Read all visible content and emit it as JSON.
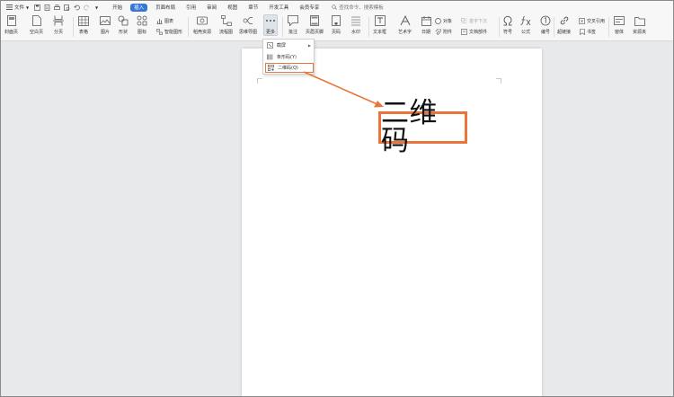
{
  "menubar": {
    "file_label": "文件",
    "tabs": [
      {
        "label": "开始",
        "active": false
      },
      {
        "label": "插入",
        "active": true
      },
      {
        "label": "页面布局",
        "active": false
      },
      {
        "label": "引用",
        "active": false
      },
      {
        "label": "审阅",
        "active": false
      },
      {
        "label": "视图",
        "active": false
      },
      {
        "label": "章节",
        "active": false
      },
      {
        "label": "开发工具",
        "active": false
      },
      {
        "label": "会员专享",
        "active": false
      }
    ],
    "search_placeholder": "查找命令、搜索模板"
  },
  "ribbon": {
    "cover": "封面页",
    "blank": "空白页",
    "pagebreak": "分页",
    "table": "表格",
    "picture": "图片",
    "shape": "形状",
    "icon": "图标",
    "chart": "图表",
    "smart": "智能图形",
    "material": "稻壳资源",
    "flow": "流程图",
    "mind": "思维导图",
    "more": "更多",
    "comment": "批注",
    "header": "页眉页脚",
    "pagenum": "页码",
    "watermark": "水印",
    "textbox": "文本框",
    "art": "艺术字",
    "date": "日期",
    "object": "对象",
    "attach": "附件",
    "dropcap": "首字下沉",
    "docpart": "文档部件",
    "symbol": "符号",
    "formula": "公式",
    "numbering": "编号",
    "hyperlink": "超链接",
    "crossref": "交叉引用",
    "bookmark": "书签",
    "window": "窗体",
    "resource": "资源夹"
  },
  "dropdown": {
    "items": [
      {
        "label": "截屏",
        "has_submenu": true
      },
      {
        "label": "条形码(Y)",
        "has_submenu": false
      },
      {
        "label": "二维码(Q)",
        "has_submenu": false
      }
    ]
  },
  "callout": {
    "text": "二维码"
  },
  "colors": {
    "accent": "#e8763c",
    "tab_active": "#3577d5"
  }
}
